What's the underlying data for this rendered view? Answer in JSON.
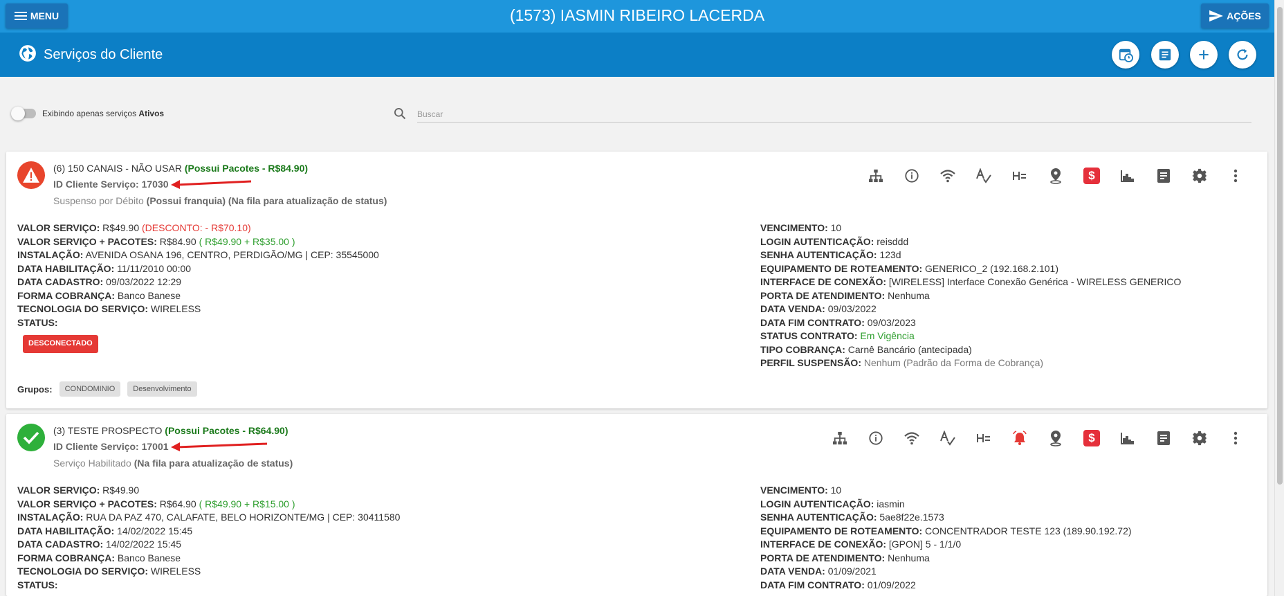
{
  "header": {
    "menu_label": "MENU",
    "title": "(1573) IASMIN RIBEIRO LACERDA",
    "actions_label": "AÇÕES"
  },
  "subheader": {
    "title": "Serviços do Cliente",
    "buttons": [
      "calendar-clock-icon",
      "list-icon",
      "plus-icon",
      "refresh-icon"
    ]
  },
  "filter": {
    "toggle_text": "Exibindo apenas serviços",
    "toggle_bold": "Ativos",
    "search_placeholder": "Buscar"
  },
  "services": [
    {
      "title": "(6) 150 CANAIS - NÃO USAR",
      "packages": "(Possui Pacotes - R$84.90)",
      "id_label": "ID Cliente Serviço: 17030",
      "status_text": "Suspenso por Débito",
      "status_bold1": "(Possui franquia)",
      "status_bold2": "(Na fila para atualização de status)",
      "left": [
        {
          "label": "VALOR SERVIÇO:",
          "value": "R$49.90",
          "extra": "(DESCONTO: - R$70.10)"
        },
        {
          "label": "VALOR SERVIÇO + PACOTES:",
          "value": "R$84.90",
          "extra": "( R$49.90 + R$35.00 )"
        },
        {
          "label": "INSTALAÇÃO:",
          "value": "AVENIDA OSANA 196, CENTRO, PERDIGÃO/MG | CEP: 35545000"
        },
        {
          "label": "DATA HABILITAÇÃO:",
          "value": "11/11/2010 00:00"
        },
        {
          "label": "DATA CADASTRO:",
          "value": "09/03/2022 12:29"
        },
        {
          "label": "FORMA COBRANÇA:",
          "value": "Banco Banese"
        },
        {
          "label": "TECNOLOGIA DO SERVIÇO:",
          "value": "WIRELESS"
        },
        {
          "label": "STATUS:",
          "value": ""
        }
      ],
      "badge": "DESCONECTADO",
      "groups_label": "Grupos:",
      "groups": [
        "CONDOMINIO",
        "Desenvolvimento"
      ],
      "right": [
        {
          "label": "VENCIMENTO:",
          "value": "10"
        },
        {
          "label": "LOGIN AUTENTICAÇÃO:",
          "value": "reisddd"
        },
        {
          "label": "SENHA AUTENTICAÇÃO:",
          "value": "123d"
        },
        {
          "label": "EQUIPAMENTO DE ROTEAMENTO:",
          "value": "GENERICO_2 (192.168.2.101)"
        },
        {
          "label": "INTERFACE DE CONEXÃO:",
          "value": "[WIRELESS] Interface Conexão Genérica - WIRELESS GENERICO"
        },
        {
          "label": "PORTA DE ATENDIMENTO:",
          "value": "Nenhuma"
        },
        {
          "label": "DATA VENDA:",
          "value": "09/03/2022"
        },
        {
          "label": "DATA FIM CONTRATO:",
          "value": "09/03/2023"
        },
        {
          "label": "STATUS CONTRATO:",
          "value": "Em Vigência"
        },
        {
          "label": "TIPO COBRANÇA:",
          "value": "Carnê Bancário (antecipada)"
        },
        {
          "label": "PERFIL SUSPENSÃO:",
          "value": "Nenhum (Padrão da Forma de Cobrança)"
        }
      ]
    },
    {
      "title": "(3) TESTE PROSPECTO",
      "packages": "(Possui Pacotes - R$64.90)",
      "id_label": "ID Cliente Serviço: 17001",
      "status_text": "Serviço Habilitado",
      "status_bold2": "(Na fila para atualização de status)",
      "left": [
        {
          "label": "VALOR SERVIÇO:",
          "value": "R$49.90"
        },
        {
          "label": "VALOR SERVIÇO + PACOTES:",
          "value": "R$64.90",
          "extra": "( R$49.90 + R$15.00 )"
        },
        {
          "label": "INSTALAÇÃO:",
          "value": "RUA DA PAZ 470, CALAFATE, BELO HORIZONTE/MG | CEP: 30411580"
        },
        {
          "label": "DATA HABILITAÇÃO:",
          "value": "14/02/2022 15:45"
        },
        {
          "label": "DATA CADASTRO:",
          "value": "14/02/2022 15:45"
        },
        {
          "label": "FORMA COBRANÇA:",
          "value": "Banco Banese"
        },
        {
          "label": "TECNOLOGIA DO SERVIÇO:",
          "value": "WIRELESS"
        },
        {
          "label": "STATUS:",
          "value": ""
        }
      ],
      "right": [
        {
          "label": "VENCIMENTO:",
          "value": "10"
        },
        {
          "label": "LOGIN AUTENTICAÇÃO:",
          "value": "iasmin"
        },
        {
          "label": "SENHA AUTENTICAÇÃO:",
          "value": "5ae8f22e.1573"
        },
        {
          "label": "EQUIPAMENTO DE ROTEAMENTO:",
          "value": "CONCENTRADOR TESTE 123 (189.90.192.72)"
        },
        {
          "label": "INTERFACE DE CONEXÃO:",
          "value": "[GPON] 5 - 1/1/0"
        },
        {
          "label": "PORTA DE ATENDIMENTO:",
          "value": "Nenhuma"
        },
        {
          "label": "DATA VENDA:",
          "value": "01/09/2021"
        },
        {
          "label": "DATA FIM CONTRATO:",
          "value": "01/09/2022"
        }
      ]
    }
  ],
  "colors": {
    "topbar": "#1e96dc",
    "subbar": "#0c7fc6",
    "warning": "#e8452c",
    "success": "#2eb03b",
    "danger": "#e53935",
    "package_green": "#1b7a1b"
  }
}
